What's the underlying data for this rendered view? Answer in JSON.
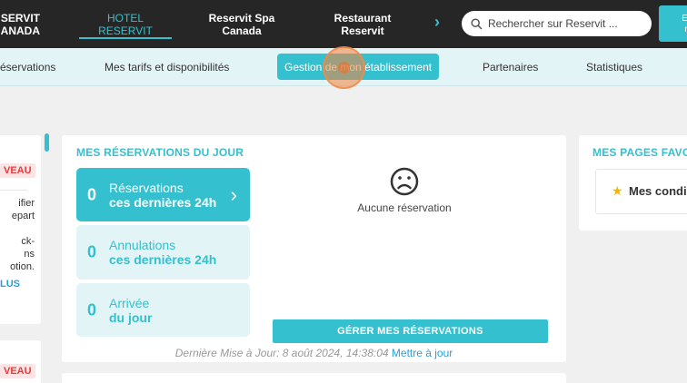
{
  "topbar": {
    "brand_line1": "SERVIT",
    "brand_line2": "ANADA",
    "items": [
      {
        "line1": "HOTEL",
        "line2": "RESERVIT"
      },
      {
        "line1": "Reservit Spa",
        "line2": "Canada"
      },
      {
        "line1": "Restaurant",
        "line2": "Reservit"
      }
    ],
    "search_placeholder": "Rechercher sur Reservit ...",
    "cta_line1": "Ef",
    "cta_line2": "r"
  },
  "subnav": {
    "items": [
      "éservations",
      "Mes tarifs et disponibilités",
      "Gestion de mon établissement",
      "Partenaires",
      "Statistiques"
    ]
  },
  "left_panel": {
    "badge1": "VEAU",
    "text_lines": [
      "ifier",
      "epart",
      "ck-",
      "ns",
      "otion."
    ],
    "link": "LUS",
    "badge2": "VEAU"
  },
  "reservations": {
    "title": "MES RÉSERVATIONS DU JOUR",
    "stats": [
      {
        "count": "0",
        "line1": "Réservations",
        "line2": "ces dernières 24h"
      },
      {
        "count": "0",
        "line1": "Annulations",
        "line2": "ces dernières 24h"
      },
      {
        "count": "0",
        "line1": "Arrivée",
        "line2": "du jour"
      }
    ],
    "empty_text": "Aucune réservation",
    "manage_button": "GÉRER MES RÉSERVATIONS",
    "last_update": "Dernière Mise à Jour: 8 août 2024, 14:38:04",
    "update_link": "Mettre à jour"
  },
  "favorites": {
    "title": "MES PAGES FAVOR",
    "item": "Mes condi"
  },
  "colors": {
    "accent": "#35c0cf",
    "topbar": "#262626",
    "alert": "#e63b3b"
  }
}
